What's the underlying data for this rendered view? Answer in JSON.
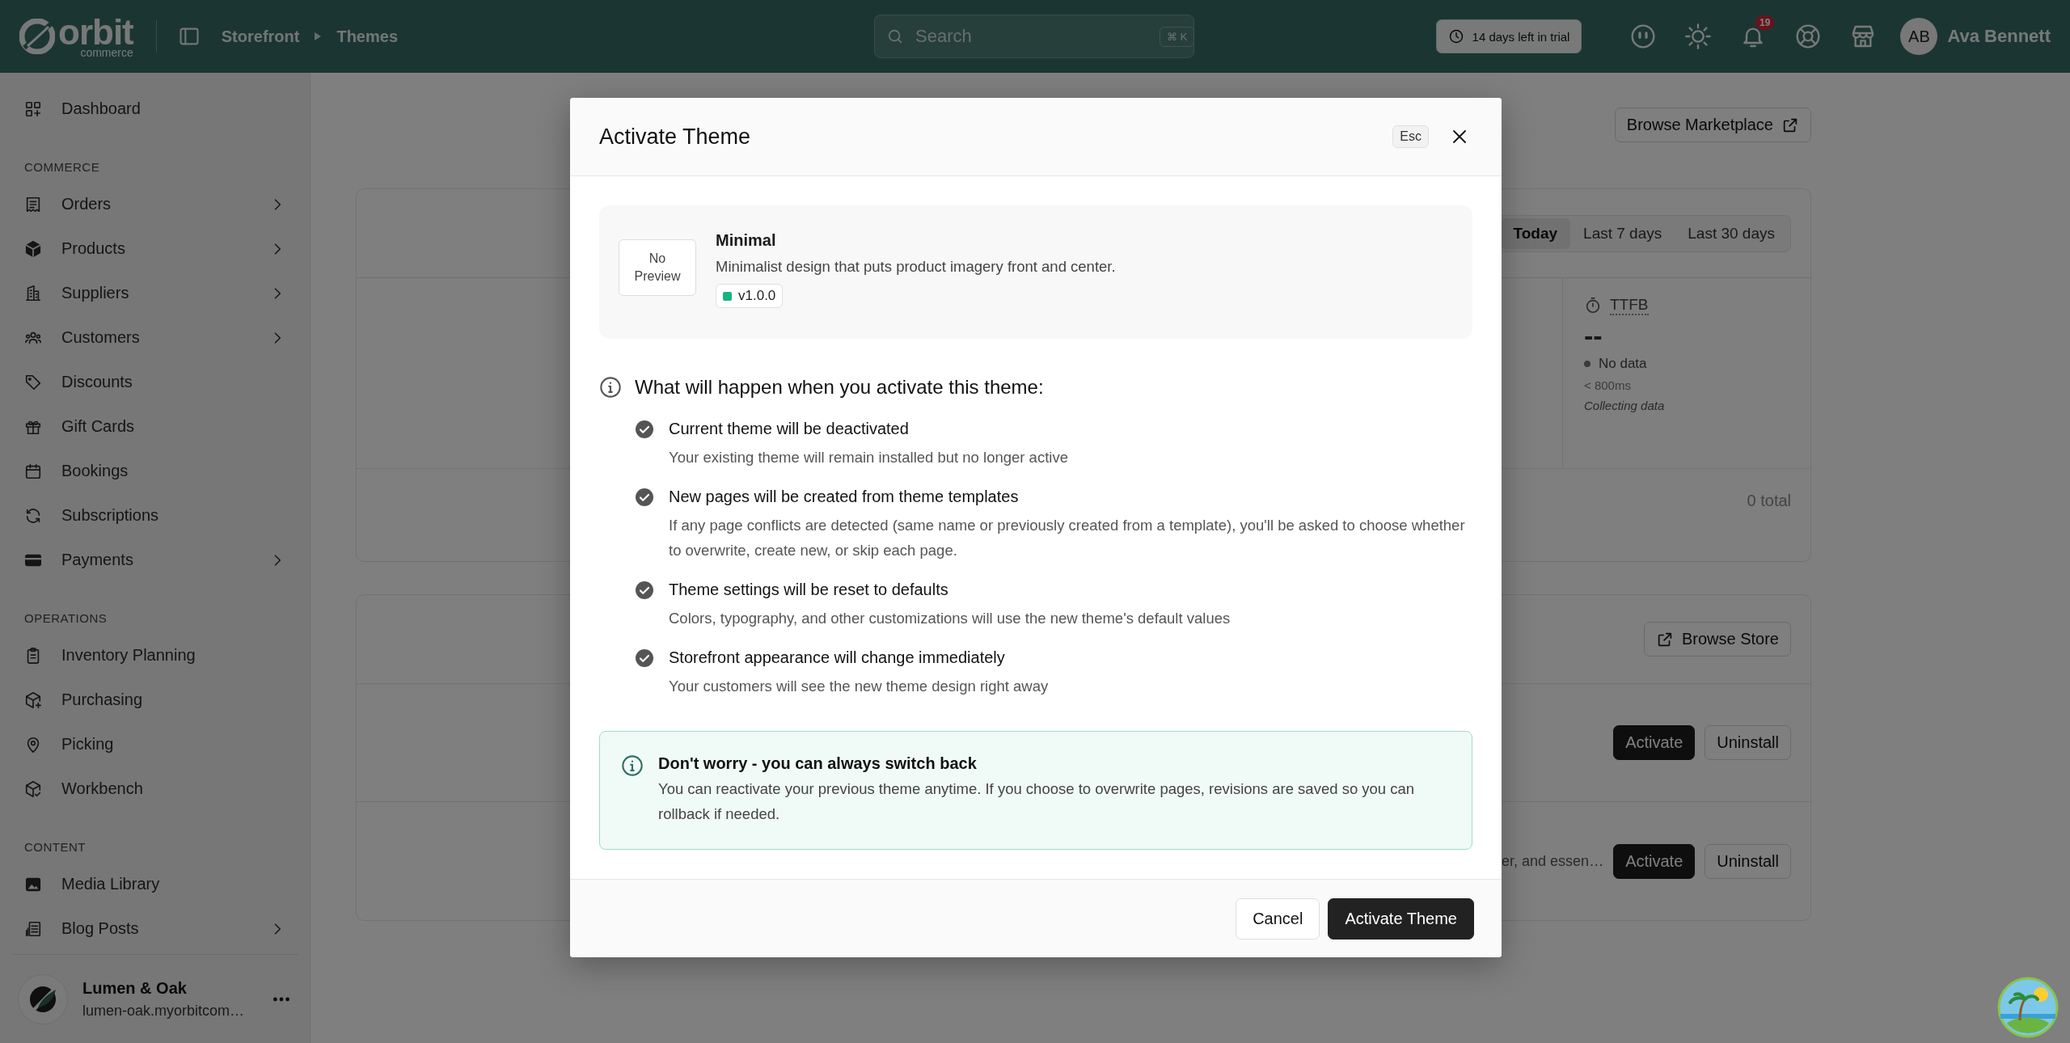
{
  "topbar": {
    "brand": {
      "name": "orbit",
      "tagline": "commerce"
    },
    "breadcrumb": [
      "Storefront",
      "Themes"
    ],
    "search": {
      "placeholder": "Search",
      "shortcut": "⌘ K"
    },
    "trial": "14 days left in trial",
    "notifications": "19",
    "user": {
      "initials": "AB",
      "name": "Ava Bennett"
    }
  },
  "sidebar": {
    "sections": [
      {
        "items": [
          {
            "label": "Dashboard",
            "expandable": false
          }
        ]
      },
      {
        "heading": "COMMERCE",
        "items": [
          {
            "label": "Orders",
            "expandable": true
          },
          {
            "label": "Products",
            "expandable": true
          },
          {
            "label": "Suppliers",
            "expandable": true
          },
          {
            "label": "Customers",
            "expandable": true
          },
          {
            "label": "Discounts",
            "expandable": false
          },
          {
            "label": "Gift Cards",
            "expandable": false
          },
          {
            "label": "Bookings",
            "expandable": false
          },
          {
            "label": "Subscriptions",
            "expandable": false
          },
          {
            "label": "Payments",
            "expandable": true
          }
        ]
      },
      {
        "heading": "OPERATIONS",
        "items": [
          {
            "label": "Inventory Planning",
            "expandable": false
          },
          {
            "label": "Purchasing",
            "expandable": false
          },
          {
            "label": "Picking",
            "expandable": false
          },
          {
            "label": "Workbench",
            "expandable": false
          }
        ]
      },
      {
        "heading": "CONTENT",
        "items": [
          {
            "label": "Media Library",
            "expandable": false
          },
          {
            "label": "Blog Posts",
            "expandable": true
          }
        ]
      }
    ],
    "store": {
      "name": "Lumen & Oak",
      "domain": "lumen-oak.myorbitcom…"
    }
  },
  "main": {
    "marketplace_button": "Browse Marketplace",
    "performance": {
      "ranges": [
        {
          "label": "Today",
          "selected": true
        },
        {
          "label": "Last 7 days",
          "selected": false
        },
        {
          "label": "Last 30 days",
          "selected": false
        }
      ],
      "metric": {
        "name": "TTFB",
        "value": "--",
        "status": "No data",
        "target": "< 800ms",
        "note": "Collecting data"
      },
      "total": "0 total"
    },
    "themes": {
      "browse_button": "Browse Store",
      "rows": [
        {
          "description": "",
          "actions": [
            "Activate",
            "Uninstall"
          ]
        },
        {
          "description": "er, and essen…",
          "actions": [
            "Activate",
            "Uninstall"
          ]
        }
      ]
    }
  },
  "modal": {
    "title": "Activate Theme",
    "esc_hint": "Esc",
    "theme": {
      "preview": "No Preview",
      "name": "Minimal",
      "description": "Minimalist design that puts product imagery front and center.",
      "version": "v1.0.0"
    },
    "changes_heading": "What will happen when you activate this theme:",
    "changes": [
      {
        "title": "Current theme will be deactivated",
        "detail": "Your existing theme will remain installed but no longer active"
      },
      {
        "title": "New pages will be created from theme templates",
        "detail": "If any page conflicts are detected (same name or previously created from a template), you'll be asked to choose whether to overwrite, create new, or skip each page."
      },
      {
        "title": "Theme settings will be reset to defaults",
        "detail": "Colors, typography, and other customizations will use the new theme's default values"
      },
      {
        "title": "Storefront appearance will change immediately",
        "detail": "Your customers will see the new theme design right away"
      }
    ],
    "notice": {
      "title": "Don't worry - you can always switch back",
      "text": "You can reactivate your previous theme anytime. If you choose to overwrite pages, revisions are saved so you can rollback if needed."
    },
    "buttons": [
      {
        "label": "Cancel",
        "kind": "secondary"
      },
      {
        "label": "Activate Theme",
        "kind": "primary"
      }
    ]
  }
}
